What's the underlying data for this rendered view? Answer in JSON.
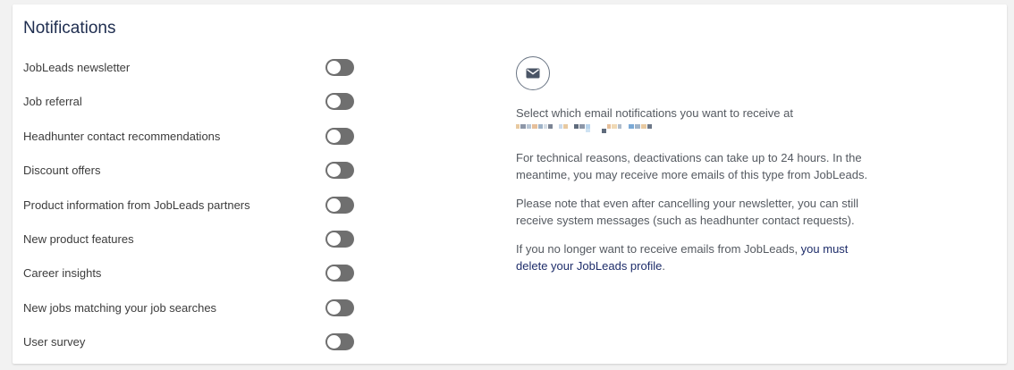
{
  "section": {
    "title": "Notifications"
  },
  "settings": [
    {
      "label": "JobLeads newsletter",
      "enabled": false
    },
    {
      "label": "Job referral",
      "enabled": false
    },
    {
      "label": "Headhunter contact recommendations",
      "enabled": false
    },
    {
      "label": "Discount offers",
      "enabled": false
    },
    {
      "label": "Product information from JobLeads partners",
      "enabled": false
    },
    {
      "label": "New product features",
      "enabled": false
    },
    {
      "label": "Career insights",
      "enabled": false
    },
    {
      "label": "New jobs matching your job searches",
      "enabled": false
    },
    {
      "label": "User survey",
      "enabled": false
    }
  ],
  "info": {
    "icon": "mail-icon",
    "select_text": "Select which email notifications you want to receive at",
    "technical_text": "For technical reasons, deactivations can take up to 24 hours. In the meantime, you may receive more emails of this type from JobLeads.",
    "system_text": "Please note that even after cancelling your newsletter, you can still receive system messages (such as headhunter contact requests).",
    "delete_prefix": "If you no longer want to receive emails from JobLeads, ",
    "delete_link": "you must delete your JobLeads profile",
    "delete_suffix": "."
  },
  "colors": {
    "title": "#1e2d4f",
    "toggle_off": "#6f6f6f",
    "link": "#1e2d6a",
    "text": "#555a61"
  }
}
